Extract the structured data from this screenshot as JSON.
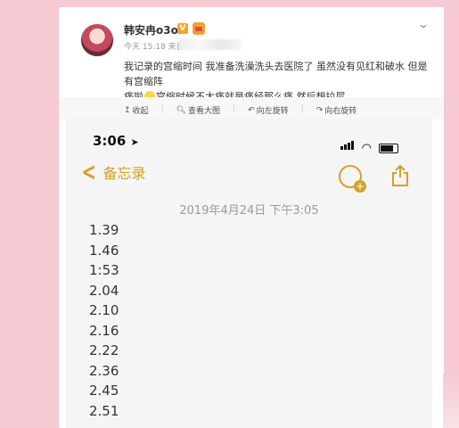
{
  "post": {
    "username": "韩安冉o3o",
    "meta": "今天 15:18 来自",
    "text_line1": "我记录的宫缩时间 我准备洗澡洗头去医院了 虽然没有见红和破水 但是有宫缩阵",
    "text_line2_a": "痛啦",
    "text_line2_b": "宫缩时候不太痛就是痛经那么痛 然后想拉屎"
  },
  "toolbar": {
    "collapse": "收起",
    "view_large": "查看大图",
    "rotate_left": "向左旋转",
    "rotate_right": "向右旋转"
  },
  "phone": {
    "time": "3:06",
    "back_label": "备忘录",
    "note_date": "2019年4月24日 下午3:05",
    "note_lines": [
      "1.39",
      "1.46",
      "1:53",
      "2.04",
      "2.10",
      "2.16",
      "2.22",
      "2.36",
      "2.45",
      "2.51"
    ]
  },
  "colors": {
    "background": "#f6c9d3",
    "notes_accent": "#d3a127"
  }
}
